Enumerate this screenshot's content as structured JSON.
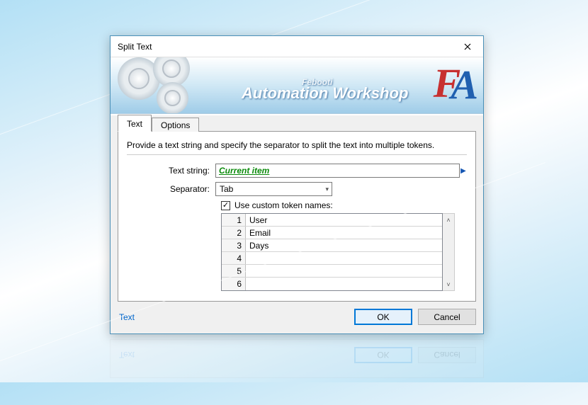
{
  "window": {
    "title": "Split Text"
  },
  "banner": {
    "brand_sub": "Febooti",
    "brand_main": "Automation Workshop"
  },
  "tabs": [
    {
      "id": "text",
      "label": "Text",
      "active": true
    },
    {
      "id": "options",
      "label": "Options",
      "active": false
    }
  ],
  "panel": {
    "description": "Provide a text string and specify the separator to split the text into multiple tokens.",
    "text_string_label": "Text string:",
    "text_string_value": "Current item",
    "separator_label": "Separator:",
    "separator_value": "Tab",
    "custom_tokens_checked": true,
    "custom_tokens_label": "Use custom token names:",
    "token_rows": [
      {
        "n": "1",
        "v": "User"
      },
      {
        "n": "2",
        "v": "Email"
      },
      {
        "n": "3",
        "v": "Days"
      },
      {
        "n": "4",
        "v": ""
      },
      {
        "n": "5",
        "v": ""
      },
      {
        "n": "6",
        "v": ""
      }
    ]
  },
  "footer": {
    "hint": "Text",
    "ok": "OK",
    "cancel": "Cancel"
  }
}
